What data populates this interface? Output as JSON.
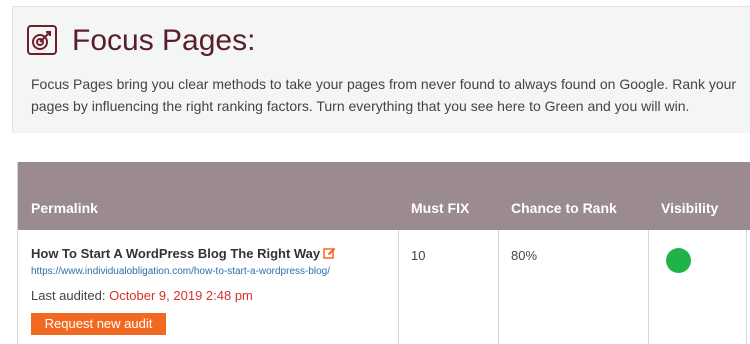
{
  "header": {
    "title": "Focus Pages:",
    "description_line1": "Focus Pages bring you clear methods to take your pages from never found to always found on Google. Rank your",
    "description_line2": "pages by influencing the right ranking factors. Turn everything that you see here to Green and you will win."
  },
  "table": {
    "columns": [
      "Permalink",
      "Must FIX",
      "Chance to Rank",
      "Visibility"
    ],
    "rows": [
      {
        "title": "How To Start A WordPress Blog The Right Way",
        "url": "https://www.individualobligation.com/how-to-start-a-wordpress-blog/",
        "last_audited_label": "Last audited:",
        "last_audited_date": "October 9, 2019 2:48 pm",
        "audit_button": "Request new audit",
        "must_fix": "10",
        "chance_to_rank": "80%",
        "visibility_status": "green"
      }
    ]
  },
  "colors": {
    "brand": "#5a1e2a",
    "header_bg": "#9b8b91",
    "audit_button": "#f26a21",
    "date_red": "#d9322b",
    "visibility_green": "#20b34a"
  },
  "icons": {
    "logo": "focus-target-icon",
    "edit": "edit-icon"
  }
}
